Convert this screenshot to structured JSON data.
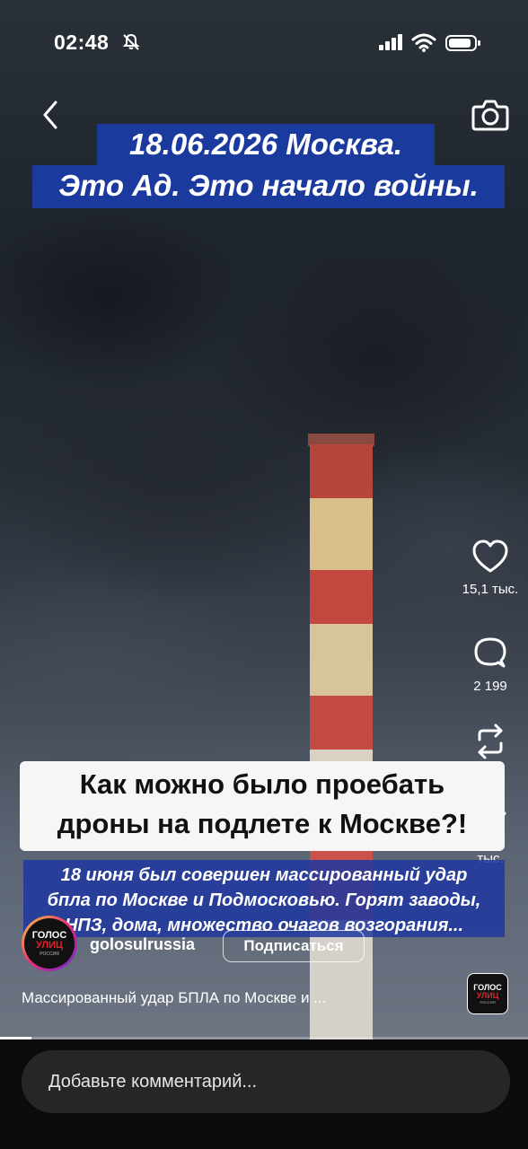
{
  "status_bar": {
    "time": "02:48"
  },
  "headline": {
    "line1": "18.06.2026 Москва.",
    "line2": "Это Ад. Это начало войны."
  },
  "actions": {
    "likes": "15,1 тыс.",
    "comments": "2 199",
    "reposts": "",
    "shares": "тыс."
  },
  "overlay_caption": {
    "line1": "Как можно было проебать",
    "line2": "дроны на подлете к Москве?!"
  },
  "overlay_text": {
    "line1": "18 июня был совершен массированный удар",
    "line2": "бпла по Москве и Подмосковью. Горят заводы,",
    "line3": "НПЗ, дома, множество очагов возгорания..."
  },
  "profile": {
    "username": "golosulrussia",
    "subscribe_label": "Подписаться",
    "avatar_text": [
      "ГОЛОС",
      "УЛИЦ",
      "РОССИЯ"
    ]
  },
  "description": "Массированный удар БПЛА по Москве и ...",
  "progress": 0.06,
  "comment_bar": {
    "placeholder": "Добавьте комментарий..."
  },
  "colors": {
    "headline_bg": "#1b3a9e",
    "accent_red": "#e0202a"
  }
}
